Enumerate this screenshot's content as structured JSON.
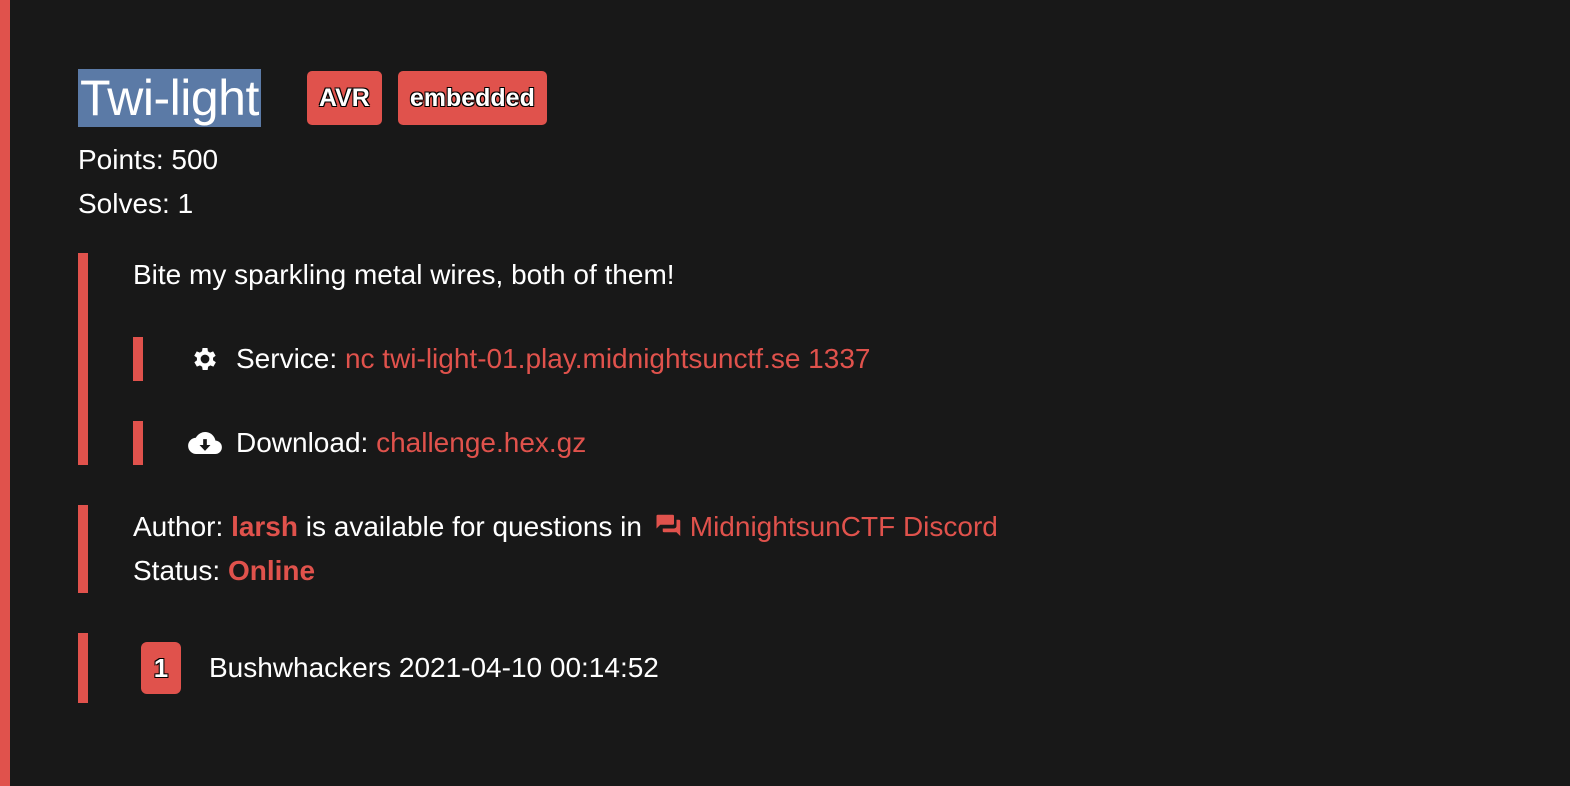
{
  "challenge": {
    "title": "Twi-light",
    "tags": [
      "AVR",
      "embedded"
    ],
    "points_label": "Points: 500",
    "solves_label": "Solves: 1",
    "description": "Bite my sparkling metal wires, both of them!",
    "service": {
      "label": "Service:",
      "value": "nc twi-light-01.play.midnightsunctf.se 1337",
      "icon": "gear-icon"
    },
    "download": {
      "label": "Download:",
      "value": "challenge.hex.gz",
      "icon": "cloud-download-icon"
    },
    "author": {
      "prefix": "Author:",
      "name": "larsh",
      "middle": "is available for questions in",
      "channel_icon": "chat-icon",
      "channel": "MidnightsunCTF Discord"
    },
    "status": {
      "label": "Status:",
      "value": "Online"
    },
    "solvers": [
      {
        "rank": "1",
        "team": "Bushwhackers",
        "time": "2021-04-10 00:14:52"
      }
    ]
  },
  "colors": {
    "accent": "#e0524c",
    "background": "#181818",
    "selection": "#5b7aa6"
  }
}
